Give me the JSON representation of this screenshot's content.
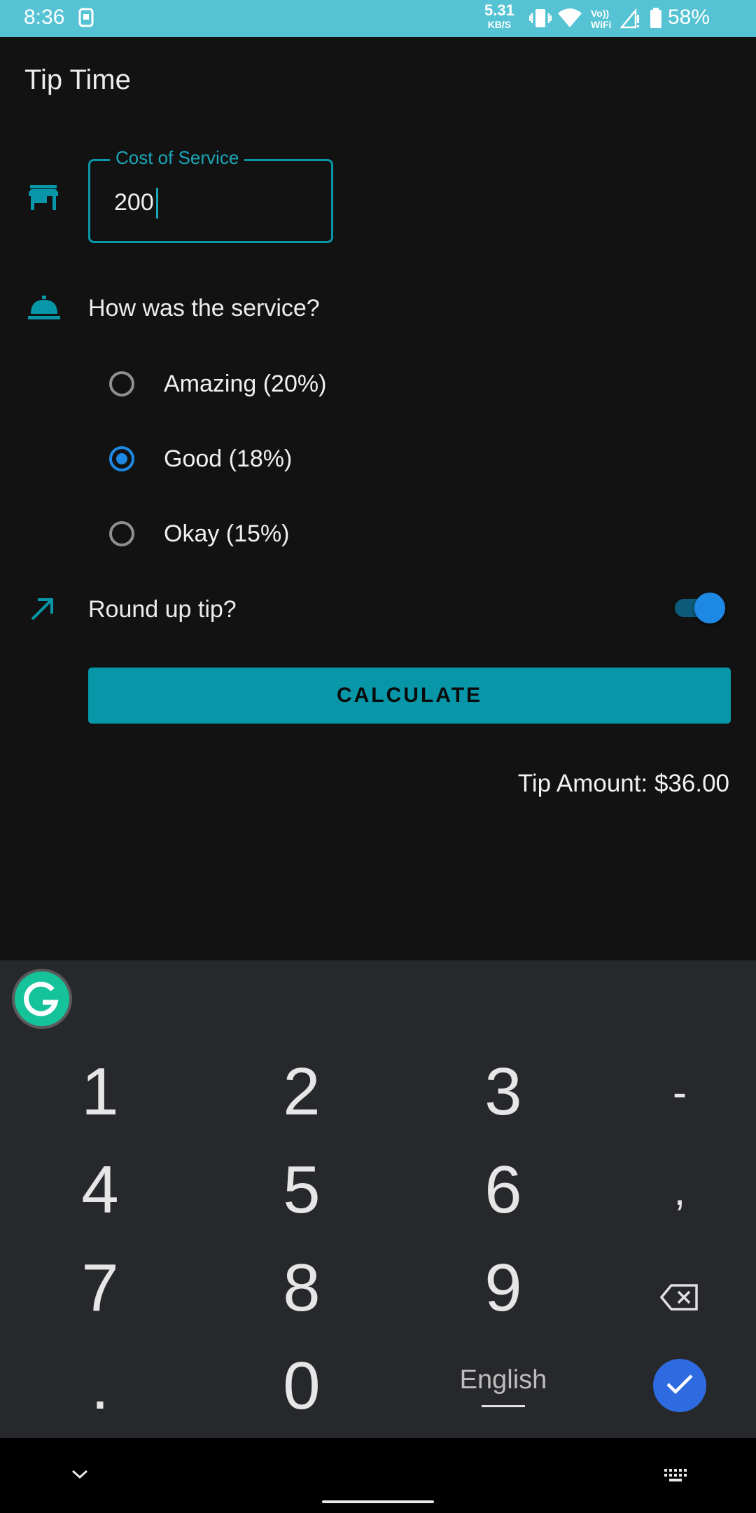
{
  "status_bar": {
    "time": "8:36",
    "speed_value": "5.31",
    "speed_unit": "KB/S",
    "battery": "58%",
    "icons": [
      "sim-icon",
      "vibrate-icon",
      "wifi-icon",
      "volte-wifi-icon",
      "signal-icon",
      "battery-icon"
    ]
  },
  "app": {
    "title": "Tip Time"
  },
  "cost_field": {
    "label": "Cost of Service",
    "value": "200"
  },
  "service": {
    "question": "How was the service?",
    "options": [
      {
        "label": "Amazing (20%)",
        "selected": false
      },
      {
        "label": "Good (18%)",
        "selected": true
      },
      {
        "label": "Okay (15%)",
        "selected": false
      }
    ]
  },
  "round_up": {
    "label": "Round up tip?",
    "on": true
  },
  "calculate": {
    "label": "CALCULATE"
  },
  "tip_amount": "Tip Amount: $36.00",
  "keyboard": {
    "row1": [
      "1",
      "2",
      "3",
      "-"
    ],
    "row2": [
      "4",
      "5",
      "6",
      ","
    ],
    "row3": [
      "7",
      "8",
      "9"
    ],
    "row4": [
      ".",
      "0"
    ],
    "language": "English"
  },
  "colors": {
    "accent": "#0797A8",
    "radio_selected": "#1E88E5",
    "status_bar": "#55C3D3",
    "keyboard_bg": "#27282C",
    "enter_key": "#2E6BE0",
    "grammarly": "#15C39A"
  }
}
